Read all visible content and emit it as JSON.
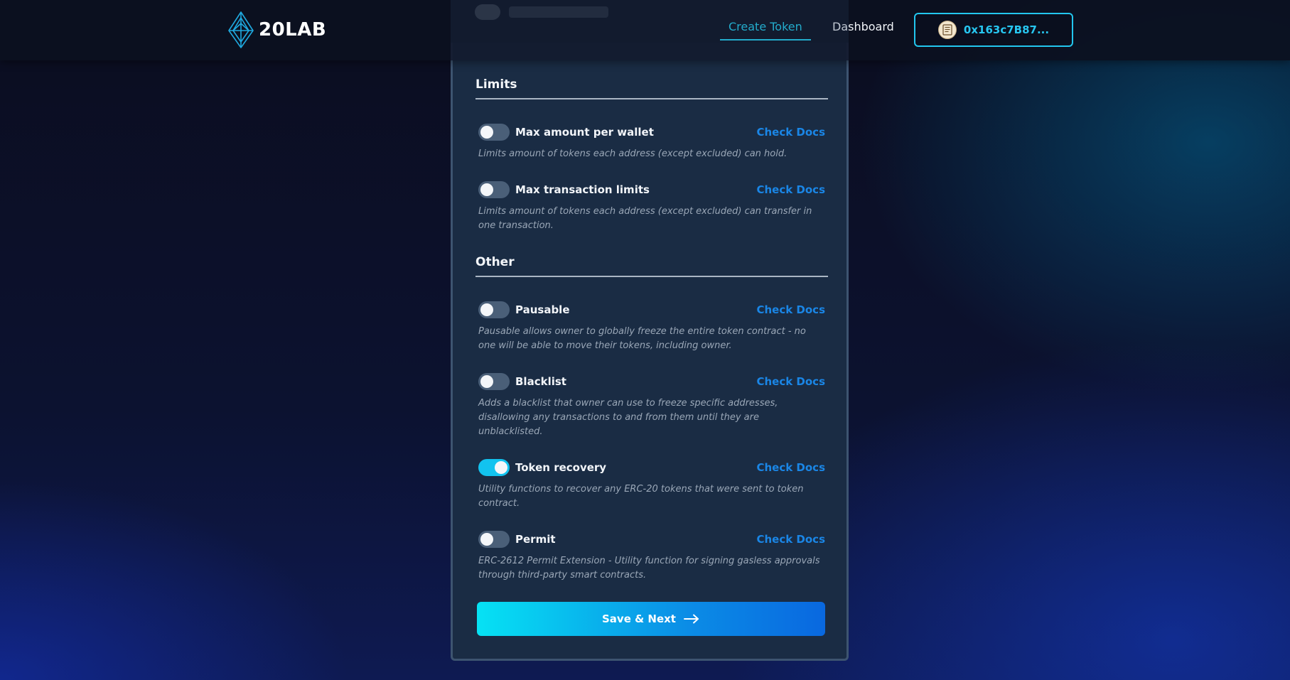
{
  "header": {
    "logo_text": "20LAB",
    "nav": [
      {
        "label": "Create Token",
        "active": true
      },
      {
        "label": "Dashboard",
        "active": false
      }
    ],
    "wallet_address": "0x163c7B87..."
  },
  "colors": {
    "accent": "#22d0f0",
    "docs_link": "#1a86e6",
    "toggle_on": "#12c3ef",
    "toggle_off": "#4a5f78"
  },
  "sections": {
    "limits": {
      "title": "Limits",
      "features": [
        {
          "label": "Max amount per wallet",
          "enabled": false,
          "docs_label": "Check Docs",
          "description": "Limits amount of tokens each address (except excluded) can hold."
        },
        {
          "label": "Max transaction limits",
          "enabled": false,
          "docs_label": "Check Docs",
          "description": "Limits amount of tokens each address (except excluded) can transfer in one transaction."
        }
      ]
    },
    "other": {
      "title": "Other",
      "features": [
        {
          "label": "Pausable",
          "enabled": false,
          "docs_label": "Check Docs",
          "description": "Pausable allows owner to globally freeze the entire token contract - no one will be able to move their tokens, including owner."
        },
        {
          "label": "Blacklist",
          "enabled": false,
          "docs_label": "Check Docs",
          "description": "Adds a blacklist that owner can use to freeze specific addresses, disallowing any transactions to and from them until they are unblacklisted."
        },
        {
          "label": "Token recovery",
          "enabled": true,
          "docs_label": "Check Docs",
          "description": "Utility functions to recover any ERC-20 tokens that were sent to token contract."
        },
        {
          "label": "Permit",
          "enabled": false,
          "docs_label": "Check Docs",
          "description": "ERC-2612 Permit Extension - Utility function for signing gasless approvals through third-party smart contracts."
        }
      ]
    }
  },
  "footer": {
    "save_label": "Save & Next"
  }
}
